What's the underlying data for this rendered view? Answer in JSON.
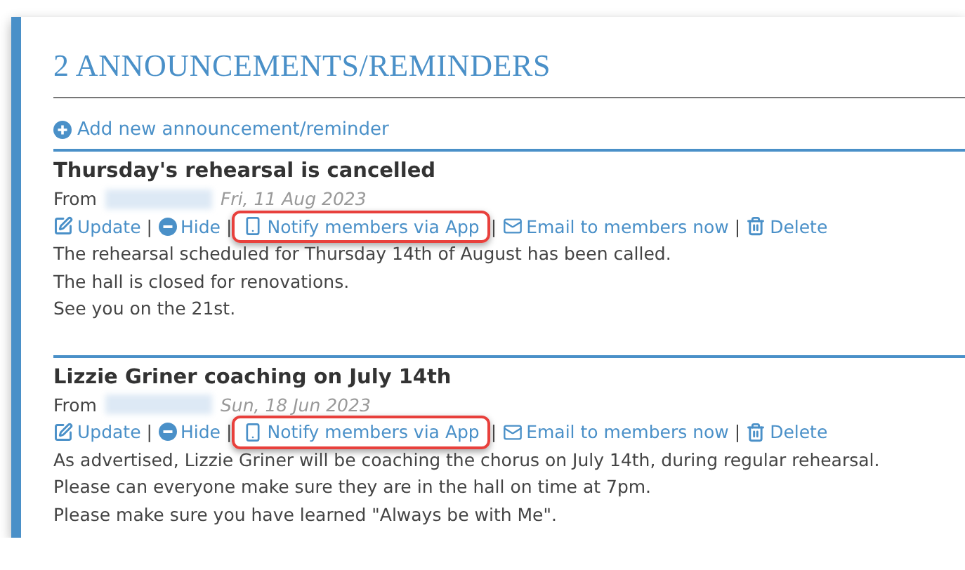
{
  "heading": "2 ANNOUNCEMENTS/REMINDERS",
  "add_link": "Add new announcement/reminder",
  "announcements": [
    {
      "title": "Thursday's rehearsal is cancelled",
      "from_label": "From",
      "date": "Fri, 11 Aug 2023",
      "actions": [
        {
          "kind": "update",
          "label": "Update",
          "highlighted": false
        },
        {
          "kind": "hide",
          "label": "Hide",
          "highlighted": false
        },
        {
          "kind": "notify",
          "label": "Notify members via App",
          "highlighted": true
        },
        {
          "kind": "email",
          "label": "Email to members now",
          "highlighted": false
        },
        {
          "kind": "delete",
          "label": "Delete",
          "highlighted": false
        }
      ],
      "separator": "|",
      "body": [
        "The rehearsal scheduled for Thursday 14th of August has been called.",
        "The hall is closed for renovations.",
        "See you on the 21st."
      ]
    },
    {
      "title": "Lizzie Griner coaching on July 14th",
      "from_label": "From",
      "date": "Sun, 18 Jun 2023",
      "actions": [
        {
          "kind": "update",
          "label": "Update",
          "highlighted": false
        },
        {
          "kind": "hide",
          "label": "Hide",
          "highlighted": false
        },
        {
          "kind": "notify",
          "label": "Notify members via App",
          "highlighted": true
        },
        {
          "kind": "email",
          "label": "Email to members now",
          "highlighted": false
        },
        {
          "kind": "delete",
          "label": "Delete",
          "highlighted": false
        }
      ],
      "separator": "|",
      "body": [
        "As advertised, Lizzie Griner will be coaching the chorus on July 14th, during regular rehearsal.",
        "Please can everyone make sure they are in the hall on time at 7pm.",
        "Please make sure you have learned \"Always be with Me\"."
      ]
    }
  ]
}
